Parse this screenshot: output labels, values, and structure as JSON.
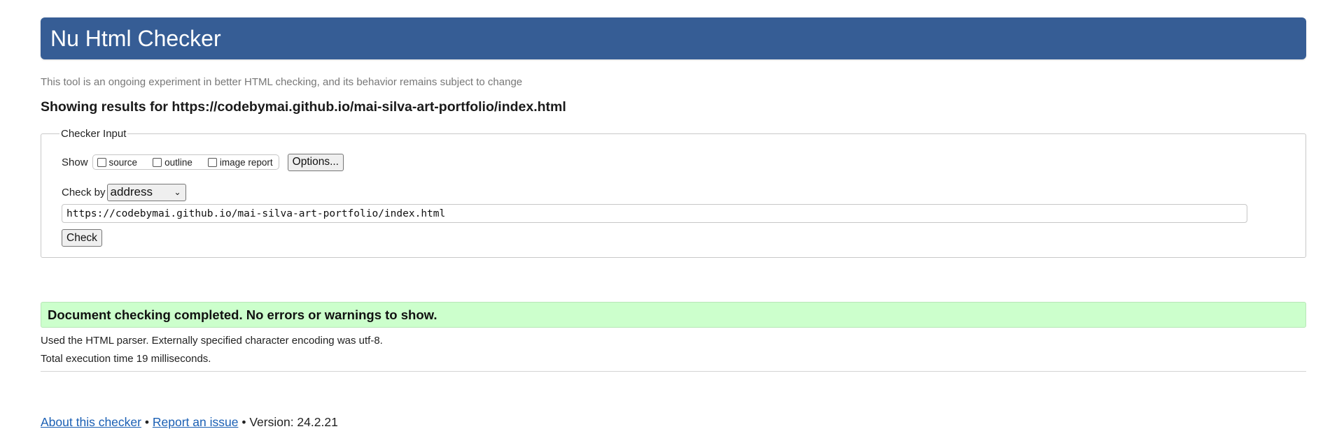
{
  "header": {
    "title": "Nu Html Checker"
  },
  "tagline": "This tool is an ongoing experiment in better HTML checking, and its behavior remains subject to change",
  "results_heading": "Showing results for https://codebymai.github.io/mai-silva-art-portfolio/index.html",
  "checker_input": {
    "legend": "Checker Input",
    "show_label": "Show",
    "options": [
      {
        "label": "source",
        "checked": false
      },
      {
        "label": "outline",
        "checked": false
      },
      {
        "label": "image report",
        "checked": false
      }
    ],
    "options_button": "Options...",
    "check_by_label": "Check by",
    "check_by_selected": "address",
    "url_value": "https://codebymai.github.io/mai-silva-art-portfolio/index.html",
    "check_button": "Check"
  },
  "result": {
    "message": "Document checking completed. No errors or warnings to show.",
    "parser_info": "Used the HTML parser. Externally specified character encoding was utf-8.",
    "execution_time": "Total execution time 19 milliseconds."
  },
  "footer": {
    "about_link": "About this checker",
    "separator": "•",
    "report_link": "Report an issue",
    "version": "Version: 24.2.21"
  },
  "colors": {
    "header_bg": "#365d95",
    "success_bg": "#ccffcc",
    "link": "#1a5fb4"
  }
}
